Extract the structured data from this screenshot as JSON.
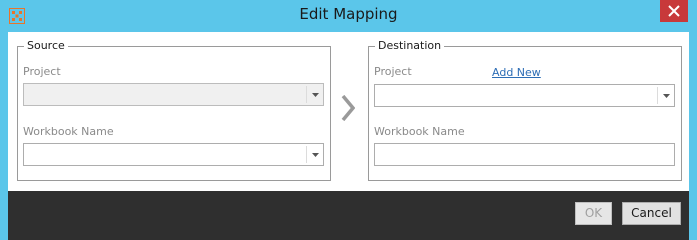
{
  "window": {
    "title": "Edit Mapping"
  },
  "source": {
    "legend": "Source",
    "project_label": "Project",
    "project_value": "",
    "workbook_label": "Workbook Name",
    "workbook_value": ""
  },
  "destination": {
    "legend": "Destination",
    "project_label": "Project",
    "add_new_label": "Add New",
    "project_value": "",
    "workbook_label": "Workbook Name",
    "workbook_value": ""
  },
  "buttons": {
    "ok": "OK",
    "cancel": "Cancel"
  },
  "colors": {
    "titlebar": "#5bc6ea",
    "close": "#c8393a",
    "footer": "#2f2f2f",
    "link": "#2d6db5"
  },
  "icons": {
    "app": "tableau-grid-icon",
    "close": "close-icon",
    "arrow": "chevron-right-icon",
    "dropdown": "caret-down-icon"
  }
}
